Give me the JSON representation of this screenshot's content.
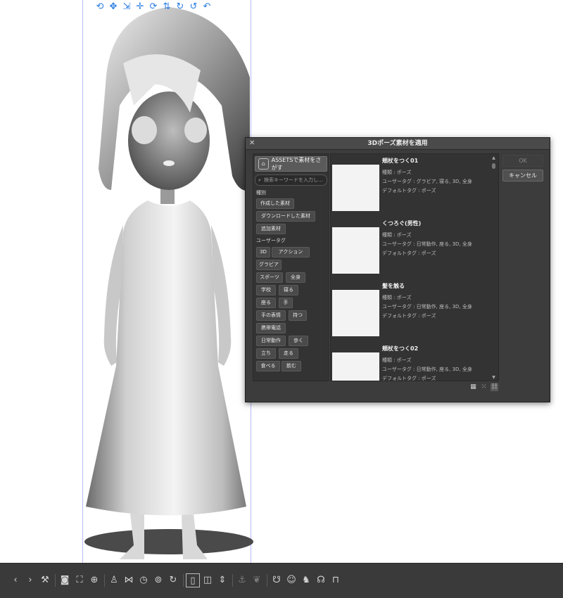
{
  "model_toolbar": {
    "icons": [
      "camera-rotate-icon",
      "camera-pan-icon",
      "camera-forward-icon",
      "move-icon",
      "rotate-icon",
      "parallel-move-icon",
      "rotate-x-icon",
      "rotate-y-icon",
      "undo-icon"
    ]
  },
  "dialog": {
    "title": "3Dポーズ素材を適用",
    "assets_button": "ASSETSで素材をさがす",
    "search_placeholder": "検索キーワードを入力し…",
    "category_label": "種別",
    "categories": [
      "作成した素材",
      "ダウンロードした素材",
      "追加素材"
    ],
    "user_tag_label": "ユーザータグ",
    "tags": [
      "3D",
      "アクション",
      "グラビア",
      "スポーツ",
      "全身",
      "学校",
      "寝る",
      "座る",
      "手",
      "手の表情",
      "持つ",
      "携帯電話",
      "日常動作",
      "歩く",
      "立ち",
      "走る",
      "食べる",
      "飲む"
    ],
    "items": [
      {
        "title": "頬杖をつく01",
        "type": "種類 : ポーズ",
        "user_tags": "ユーザータグ : グラビア, 寝る, 3D, 全身",
        "default_tag": "デフォルトタグ : ポーズ"
      },
      {
        "title": "くつろぐ(男性)",
        "type": "種類 : ポーズ",
        "user_tags": "ユーザータグ : 日常動作, 座る, 3D, 全身",
        "default_tag": "デフォルトタグ : ポーズ"
      },
      {
        "title": "髪を触る",
        "type": "種類 : ポーズ",
        "user_tags": "ユーザータグ : 日常動作, 座る, 3D, 全身",
        "default_tag": "デフォルトタグ : ポーズ"
      },
      {
        "title": "頬杖をつく02",
        "type": "種類 : ポーズ",
        "user_tags": "ユーザータグ : 日常動作, 座る, 3D, 全身",
        "default_tag": "デフォルトタグ : ポーズ"
      }
    ],
    "ok_label": "OK",
    "cancel_label": "キャンセル"
  },
  "bottom_toolbar": {
    "icons": [
      "back-icon",
      "forward-icon",
      "wrench-icon",
      "camera-icon",
      "fit-icon",
      "ground-icon",
      "pose-icon",
      "flip-icon",
      "timer-icon",
      "zoom-icon",
      "refresh-icon",
      "frame-icon",
      "figure-icon",
      "move-down-icon",
      "move-up-icon",
      "material-icon",
      "cat-icon",
      "animal-icon",
      "head-icon",
      "lock-icon"
    ]
  },
  "colors": {
    "dialog_bg": "#3c3c3c",
    "toolbar_bg": "#3a3a3a",
    "model_toolbar_icons": "#2a7de1"
  }
}
